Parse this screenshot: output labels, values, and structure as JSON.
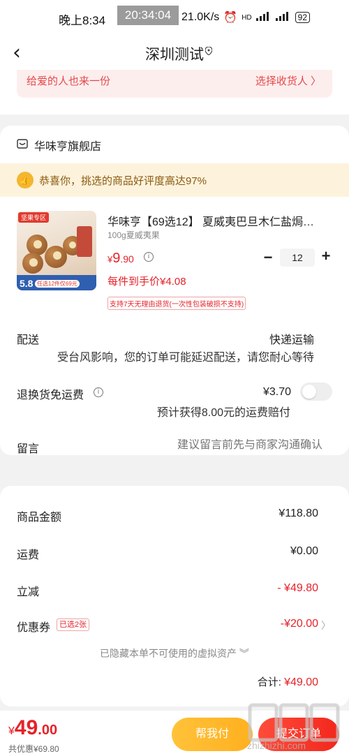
{
  "status_bar": {
    "time": "晚上8:34",
    "clock_overlay": "20:34:04",
    "network_speed": "21.0K/s",
    "battery": "92"
  },
  "nav": {
    "title": "深圳测试"
  },
  "address": {
    "gift_text": "给爱的人也来一份",
    "select_receiver": "选择收货人 〉"
  },
  "store": {
    "name": "华味亨旗舰店",
    "praise_text": "恭喜你，挑选的商品好评度高达97%",
    "product": {
      "image_tag": "坚果专区",
      "image_badge_number": "5.8",
      "image_badge_text": "任选12件仅69元",
      "title": "华味亨【69选12】 夏威夷巴旦木仁盐焗…",
      "spec": "100g夏威夷果",
      "price_symbol": "¥",
      "price_int": "9",
      "price_dec": ".90",
      "quantity": "12",
      "unit_price": "每件到手价¥4.08",
      "return_policy": "支持7天无理由退货(一次性包装破损不支持)"
    },
    "delivery": {
      "label": "配送",
      "method": "快递运输",
      "note": "受台风影响，您的订单可能延迟配送，请您耐心等待"
    },
    "shipping_insurance": {
      "label": "退换货免运费",
      "price": "¥3.70",
      "compensation": "预计获得8.00元的运费赔付",
      "enabled": false
    },
    "message": {
      "label": "留言",
      "placeholder": "建议留言前先与商家沟通确认"
    }
  },
  "summary": {
    "goods_label": "商品金额",
    "goods_value": "¥118.80",
    "shipping_label": "运费",
    "shipping_value": "¥0.00",
    "discount_label": "立减",
    "discount_value": "- ¥49.80",
    "coupon_label": "优惠券",
    "coupon_tag": "已选2张",
    "coupon_value": "-¥20.00",
    "hidden_assets": "已隐藏本单不可使用的虚拟资产 ︾",
    "total_label": "合计:",
    "total_value": "¥49.00"
  },
  "bottom": {
    "price_symbol": "¥",
    "price_int": "49",
    "price_dec": ".00",
    "saving": "共优惠¥69.80",
    "help_pay": "帮我付",
    "submit": "提交订单",
    "watermark": "zhizhizhi.com"
  },
  "colors": {
    "accent_red": "#e5232a",
    "help_pay_yellow": "#ffb01f",
    "submit_red": "#f2271c",
    "praise_bg": "#fdf3dc"
  }
}
